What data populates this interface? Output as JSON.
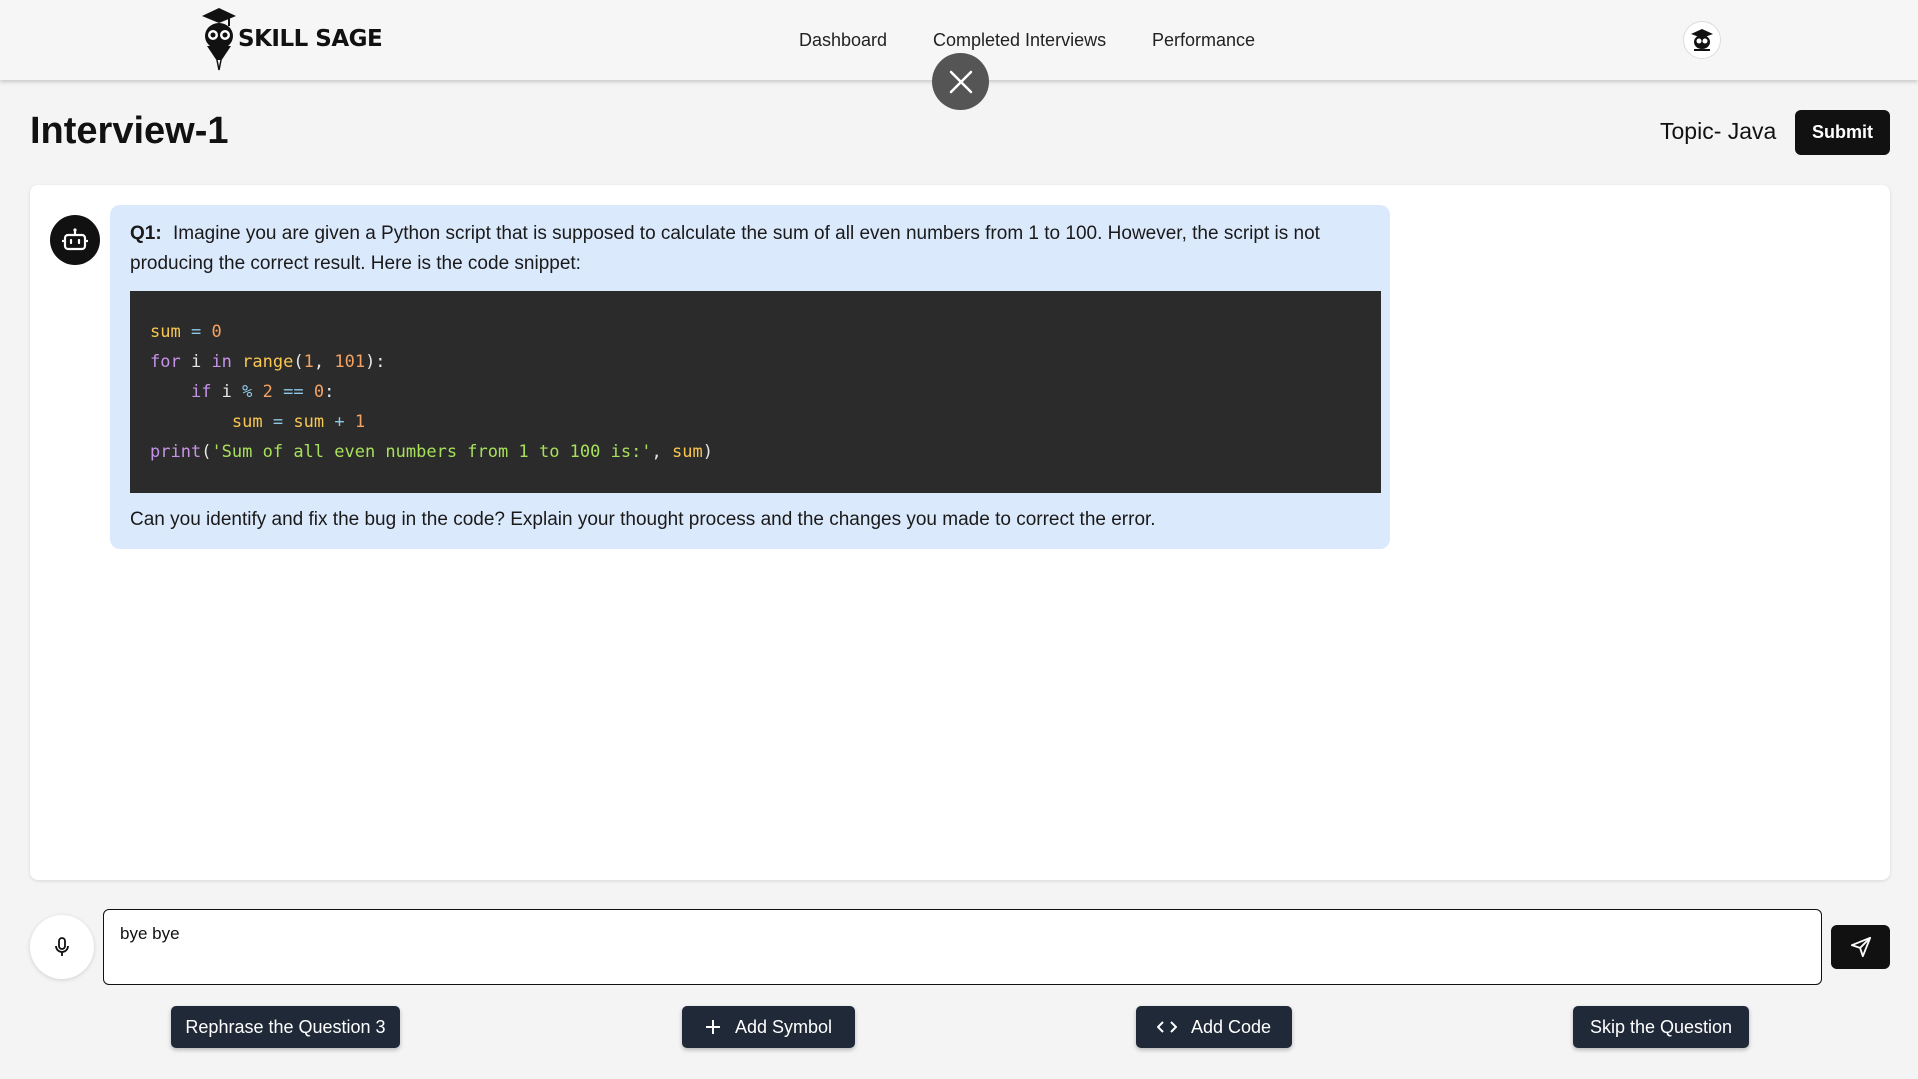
{
  "header": {
    "brand": "SKILL SAGE",
    "nav": [
      "Dashboard",
      "Completed Interviews",
      "Performance"
    ]
  },
  "page": {
    "title": "Interview-1",
    "topic": "Topic- Java",
    "submit_label": "Submit"
  },
  "chat": {
    "question_label": "Q1:",
    "question_text": "Imagine you are given a Python script that is supposed to calculate the sum of all even numbers from 1 to 100. However, the script is not producing the correct result. Here is the code snippet:",
    "code_lines": [
      "sum = 0",
      "for i in range(1, 101):",
      "    if i % 2 == 0:",
      "        sum = sum + 1",
      "print('Sum of all even numbers from 1 to 100 is:', sum)"
    ],
    "followup": "Can you identify and fix the bug in the code? Explain your thought process and the changes you made to correct the error."
  },
  "input": {
    "value": "bye bye"
  },
  "actions": {
    "rephrase": "Rephrase the Question 3",
    "add_symbol": "Add Symbol",
    "add_code": "Add Code",
    "skip": "Skip the Question"
  },
  "colors": {
    "bubble_bg": "#dbe9fc",
    "code_bg": "#2b2b2b",
    "button_dark": "#1f2937"
  }
}
